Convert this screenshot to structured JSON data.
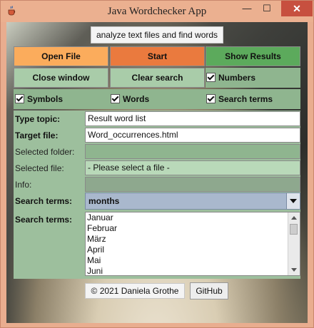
{
  "window": {
    "title": "Java Wordchecker App",
    "minimize": "—",
    "maximize": "☐",
    "close": "✕"
  },
  "subtitle": "analyze text files and find words",
  "buttons": {
    "open_file": "Open File",
    "start": "Start",
    "show_results": "Show Results",
    "close_window": "Close window",
    "clear_search": "Clear search"
  },
  "checkboxes": {
    "numbers": {
      "label": "Numbers",
      "checked": true
    },
    "symbols": {
      "label": "Symbols",
      "checked": true
    },
    "words": {
      "label": "Words",
      "checked": true
    },
    "search_terms": {
      "label": "Search terms",
      "checked": true
    }
  },
  "form": {
    "type_topic": {
      "label": "Type topic:",
      "value": "Result word list"
    },
    "target_file": {
      "label": "Target file:",
      "value": "Word_occurrences.html"
    },
    "selected_folder": {
      "label": "Selected folder:",
      "value": ""
    },
    "selected_file": {
      "label": "Selected file:",
      "value": "- Please select a file -"
    },
    "info": {
      "label": "Info:",
      "value": ""
    },
    "search_terms_combo": {
      "label": "Search terms:",
      "value": "months"
    },
    "search_terms_list": {
      "label": "Search terms:",
      "items": [
        "Januar",
        "Februar",
        "März",
        "April",
        "Mai",
        "Juni"
      ]
    }
  },
  "footer": {
    "copyright": "© 2021 Daniela Grothe",
    "github": "GitHub"
  },
  "colors": {
    "orange": "#fbac5c",
    "dark_orange": "#ea7a3e",
    "green": "#5caa5c",
    "panel_green": "#9dbf9d",
    "close_red": "#c7503f"
  }
}
